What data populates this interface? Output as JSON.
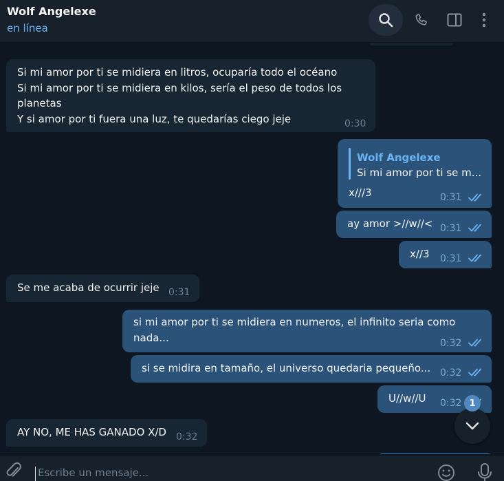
{
  "header": {
    "contact_name": "Wolf Angelexe",
    "status": "en línea",
    "icons": [
      "search-icon",
      "phone-icon",
      "sidebar-panel-icon",
      "more-vertical-icon"
    ]
  },
  "messages": [
    {
      "direction": "incoming",
      "text": "Si mi amor por ti se midiera en litros, ocuparía todo el océano\nSi mi amor por ti se midiera en kilos, sería el peso de todos los\nplanetas\nY si amor por ti fuera una luz, te quedarías ciego jeje",
      "time": "0:30"
    },
    {
      "direction": "outgoing",
      "reply_to": {
        "name": "Wolf Angelexe",
        "text": "Si mi amor por ti se m..."
      },
      "text": "x///3",
      "time": "0:31",
      "read": true
    },
    {
      "direction": "outgoing",
      "text": "ay amor >//w//<",
      "time": "0:31",
      "read": true
    },
    {
      "direction": "outgoing",
      "text": "x//3",
      "time": "0:31",
      "read": true
    },
    {
      "direction": "incoming",
      "text": "Se me acaba de ocurrir jeje",
      "time": "0:31"
    },
    {
      "direction": "outgoing",
      "text": "si mi amor por ti se midiera en numeros, el infinito seria como\nnada...",
      "time": "0:32",
      "read": true
    },
    {
      "direction": "outgoing",
      "text": "si se midira en tamaño, el universo quedaria pequeño...",
      "time": "0:32",
      "read": true
    },
    {
      "direction": "outgoing",
      "text": "U//w//U",
      "time": "0:32",
      "read": true
    },
    {
      "direction": "incoming",
      "text": "AY NO, ME HAS GANADO X/D",
      "time": "0:32"
    }
  ],
  "scroll_down": {
    "unread_count": "1",
    "icon": "chevron-down-icon"
  },
  "composer": {
    "placeholder": "Escribe un mensaje...",
    "value": "",
    "icons": [
      "paperclip-icon",
      "emoji-icon",
      "microphone-icon"
    ]
  },
  "colors": {
    "background": "#0e1621",
    "panel": "#17212b",
    "incoming_bubble": "#182533",
    "outgoing_bubble": "#2b5278",
    "accent": "#6ab3f3",
    "badge": "#5288c1"
  }
}
